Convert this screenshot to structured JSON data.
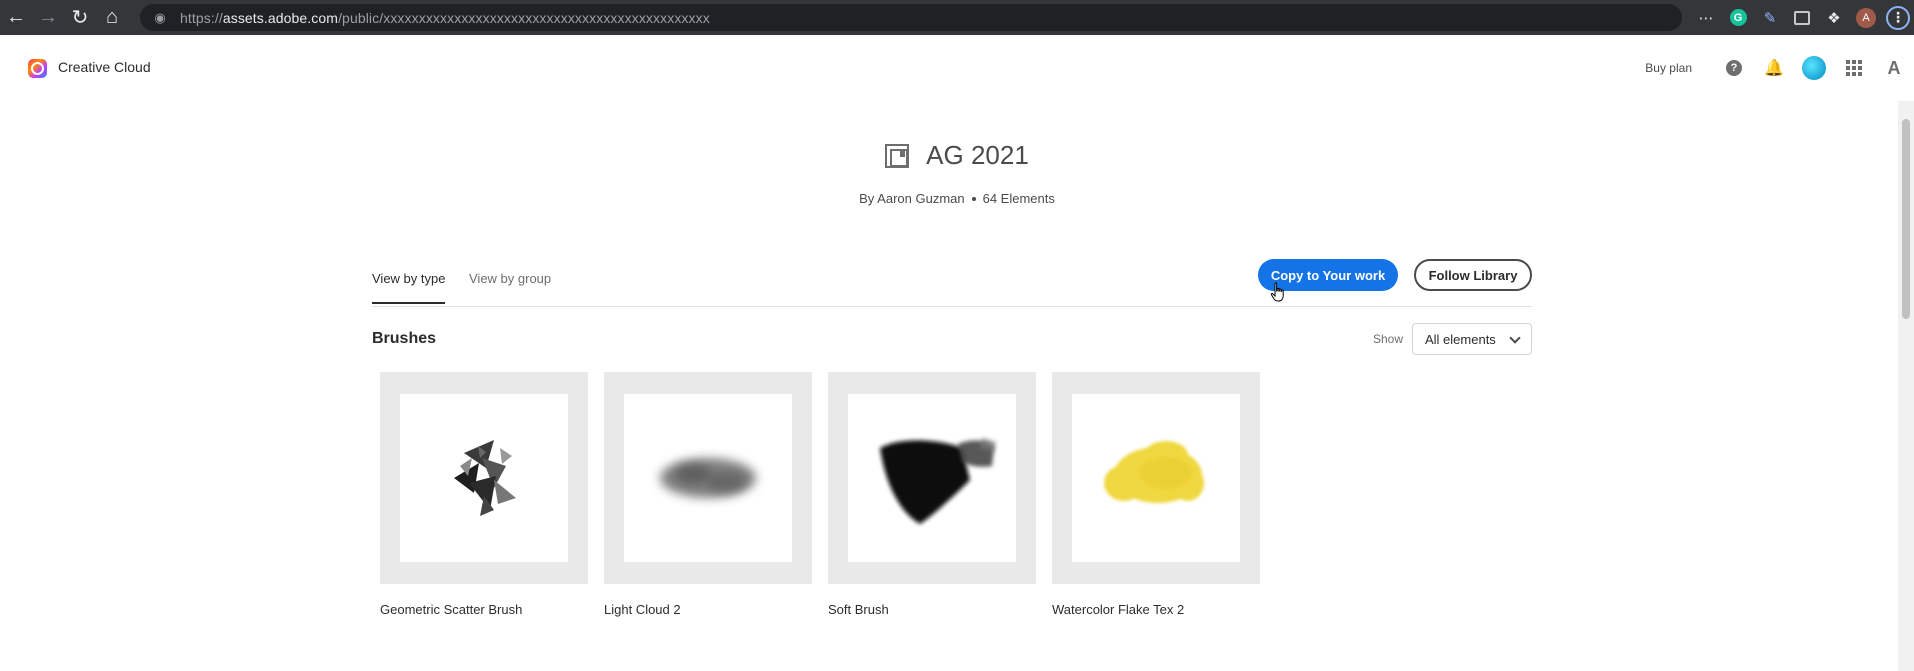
{
  "browser": {
    "url_scheme": "https://",
    "url_host": "assets.adobe.com",
    "url_path": "/public/xxxxxxxxxxxxxxxxxxxxxxxxxxxxxxxxxxxxxxxxxxxxxx",
    "profile_initial": "A",
    "grammarly_letter": "G"
  },
  "header": {
    "app_title": "Creative Cloud",
    "buy_plan": "Buy plan",
    "help_glyph": "?"
  },
  "library": {
    "title": "AG 2021",
    "author": "By Aaron Guzman",
    "count": "64 Elements"
  },
  "tabs": [
    {
      "label": "View by type",
      "active": true
    },
    {
      "label": "View by group",
      "active": false
    }
  ],
  "actions": {
    "copy_label": "Copy to Your work",
    "follow_label": "Follow Library"
  },
  "section": {
    "title": "Brushes",
    "show_label": "Show",
    "filter_value": "All elements"
  },
  "brushes": [
    {
      "name": "Geometric Scatter Brush",
      "icon": "geometric-scatter-swatch"
    },
    {
      "name": "Light Cloud 2",
      "icon": "light-cloud-swatch"
    },
    {
      "name": "Soft Brush",
      "icon": "soft-brush-swatch"
    },
    {
      "name": "Watercolor Flake Tex 2",
      "icon": "watercolor-flake-swatch",
      "color": "#f0d840"
    }
  ],
  "colors": {
    "accent": "#1473e6",
    "chrome_bg": "#35363a"
  }
}
